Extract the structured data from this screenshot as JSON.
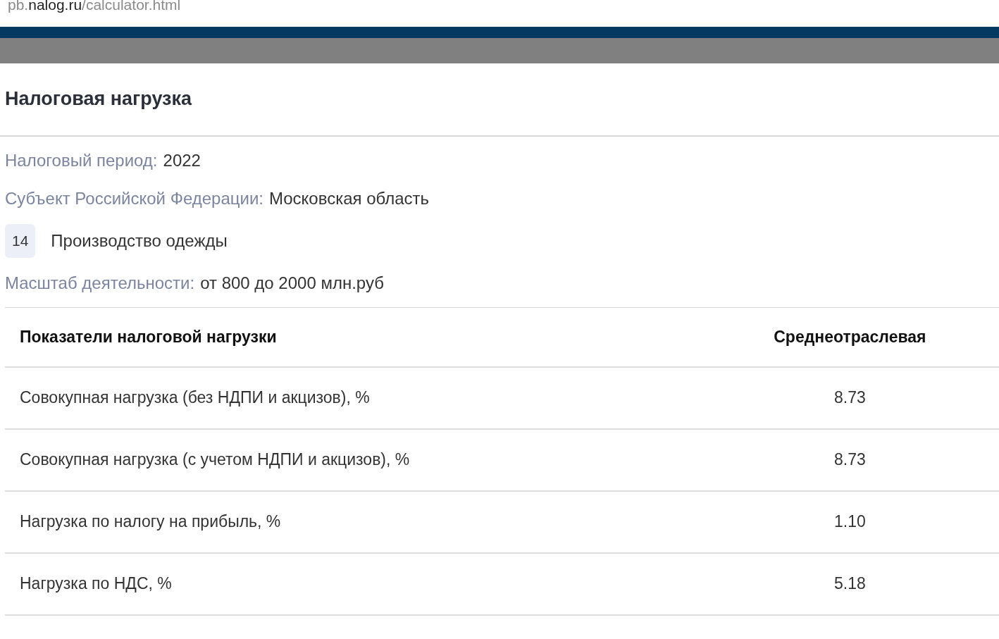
{
  "address_bar": {
    "prefix": "pb.",
    "domain": "nalog.ru",
    "path": "/calculator.html"
  },
  "title": "Налоговая нагрузка",
  "info": [
    {
      "label": "Налоговый период:",
      "value": "2022"
    },
    {
      "label": "Субъект Российской Федерации:",
      "value": "Московская область"
    }
  ],
  "activity": {
    "code": "14",
    "name": "Производство одежды"
  },
  "scale": {
    "label": "Масштаб деятельности:",
    "value": "от 800 до 2000 млн.руб"
  },
  "table": {
    "columns": [
      "Показатели налоговой нагрузки",
      "Среднеотраслевая"
    ],
    "rows": [
      {
        "indicator": "Совокупная нагрузка (без НДПИ и акцизов), %",
        "average": "8.73"
      },
      {
        "indicator": "Совокупная нагрузка (с учетом НДПИ и акцизов), %",
        "average": "8.73"
      },
      {
        "indicator": "Нагрузка по налогу на прибыль, %",
        "average": "1.10"
      },
      {
        "indicator": "Нагрузка по НДС, %",
        "average": "5.18"
      }
    ]
  }
}
